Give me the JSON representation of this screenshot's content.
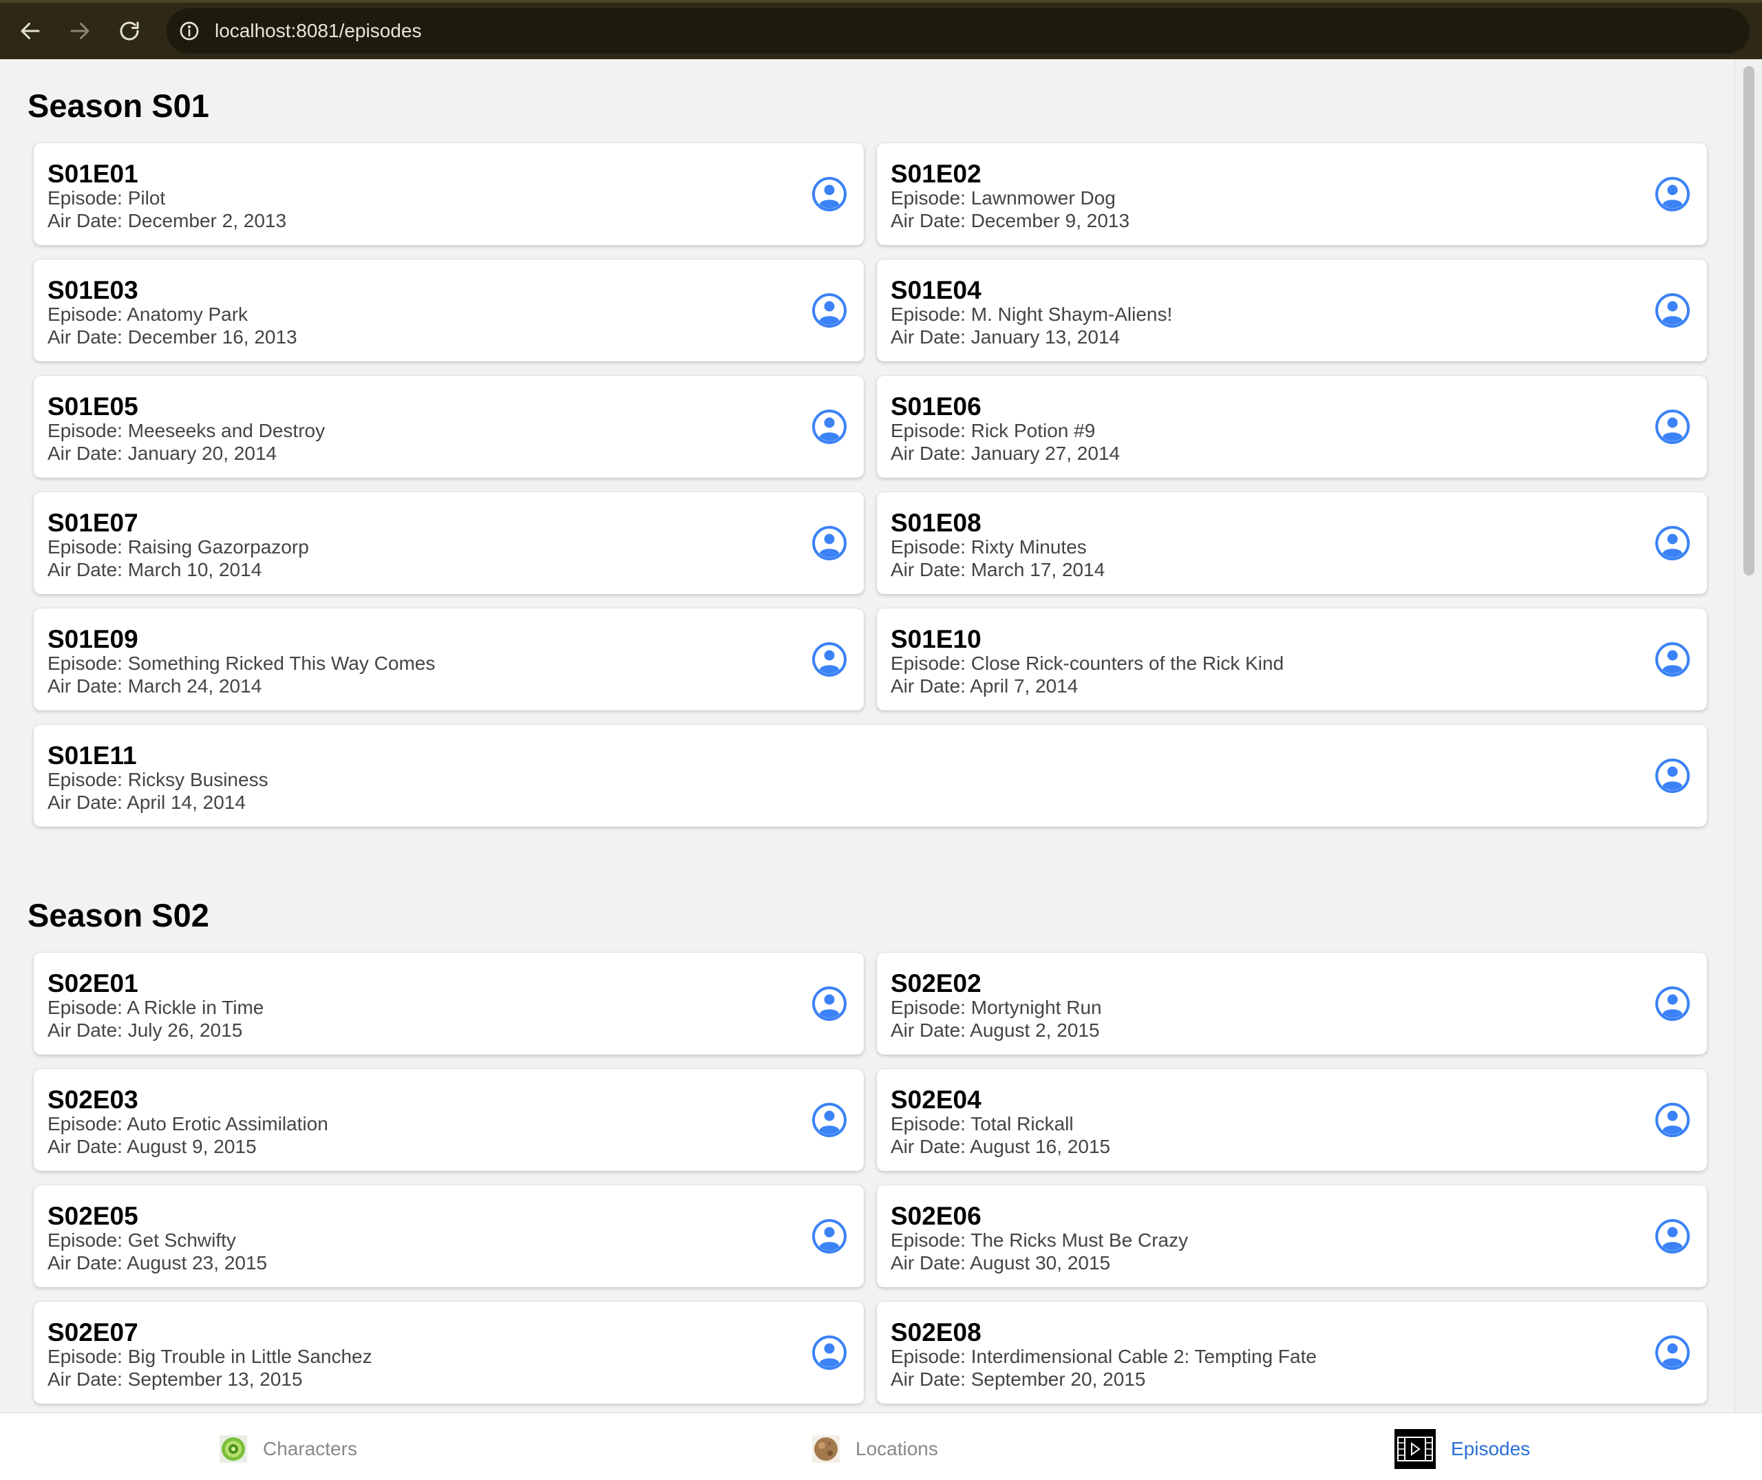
{
  "browser": {
    "url": "localhost:8081/episodes"
  },
  "colors": {
    "accent": "#2b6fd6",
    "person_icon": "#3b82f6"
  },
  "seasons": [
    {
      "title": "Season S01",
      "episodes": [
        {
          "code": "S01E01",
          "episode": "Episode: Pilot",
          "air_date": "Air Date: December 2, 2013"
        },
        {
          "code": "S01E02",
          "episode": "Episode: Lawnmower Dog",
          "air_date": "Air Date: December 9, 2013"
        },
        {
          "code": "S01E03",
          "episode": "Episode: Anatomy Park",
          "air_date": "Air Date: December 16, 2013"
        },
        {
          "code": "S01E04",
          "episode": "Episode: M. Night Shaym-Aliens!",
          "air_date": "Air Date: January 13, 2014"
        },
        {
          "code": "S01E05",
          "episode": "Episode: Meeseeks and Destroy",
          "air_date": "Air Date: January 20, 2014"
        },
        {
          "code": "S01E06",
          "episode": "Episode: Rick Potion #9",
          "air_date": "Air Date: January 27, 2014"
        },
        {
          "code": "S01E07",
          "episode": "Episode: Raising Gazorpazorp",
          "air_date": "Air Date: March 10, 2014"
        },
        {
          "code": "S01E08",
          "episode": "Episode: Rixty Minutes",
          "air_date": "Air Date: March 17, 2014"
        },
        {
          "code": "S01E09",
          "episode": "Episode: Something Ricked This Way Comes",
          "air_date": "Air Date: March 24, 2014"
        },
        {
          "code": "S01E10",
          "episode": "Episode: Close Rick-counters of the Rick Kind",
          "air_date": "Air Date: April 7, 2014"
        },
        {
          "code": "S01E11",
          "episode": "Episode: Ricksy Business",
          "air_date": "Air Date: April 14, 2014"
        }
      ]
    },
    {
      "title": "Season S02",
      "episodes": [
        {
          "code": "S02E01",
          "episode": "Episode: A Rickle in Time",
          "air_date": "Air Date: July 26, 2015"
        },
        {
          "code": "S02E02",
          "episode": "Episode: Mortynight Run",
          "air_date": "Air Date: August 2, 2015"
        },
        {
          "code": "S02E03",
          "episode": "Episode: Auto Erotic Assimilation",
          "air_date": "Air Date: August 9, 2015"
        },
        {
          "code": "S02E04",
          "episode": "Episode: Total Rickall",
          "air_date": "Air Date: August 16, 2015"
        },
        {
          "code": "S02E05",
          "episode": "Episode: Get Schwifty",
          "air_date": "Air Date: August 23, 2015"
        },
        {
          "code": "S02E06",
          "episode": "Episode: The Ricks Must Be Crazy",
          "air_date": "Air Date: August 30, 2015"
        },
        {
          "code": "S02E07",
          "episode": "Episode: Big Trouble in Little Sanchez",
          "air_date": "Air Date: September 13, 2015"
        },
        {
          "code": "S02E08",
          "episode": "Episode: Interdimensional Cable 2: Tempting Fate",
          "air_date": "Air Date: September 20, 2015"
        }
      ]
    }
  ],
  "tabs": [
    {
      "label": "Characters",
      "icon": "portal-icon",
      "active": false
    },
    {
      "label": "Locations",
      "icon": "planet-icon",
      "active": false
    },
    {
      "label": "Episodes",
      "icon": "film-icon",
      "active": true
    }
  ]
}
